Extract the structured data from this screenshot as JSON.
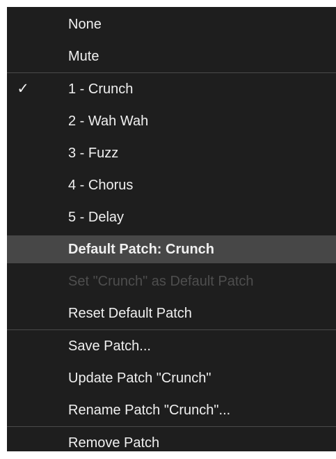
{
  "menu": {
    "none": "None",
    "mute": "Mute",
    "patches": [
      {
        "label": "1 - Crunch",
        "checkmark": "✓"
      },
      {
        "label": "2 - Wah Wah"
      },
      {
        "label": "3 - Fuzz"
      },
      {
        "label": "4 - Chorus"
      },
      {
        "label": "5 - Delay"
      }
    ],
    "default_header": "Default Patch: Crunch",
    "set_default": "Set \"Crunch\" as Default Patch",
    "reset_default": "Reset Default Patch",
    "save_patch": "Save Patch...",
    "update_patch": "Update Patch \"Crunch\"",
    "rename_patch": "Rename Patch \"Crunch\"...",
    "remove_patch": "Remove Patch"
  },
  "colors": {
    "menu_background": "#1e1e1e",
    "text": "#f0f0f0",
    "disabled_text": "#4e4e4e",
    "highlight": "#474747",
    "separator": "#4a4a4a"
  }
}
